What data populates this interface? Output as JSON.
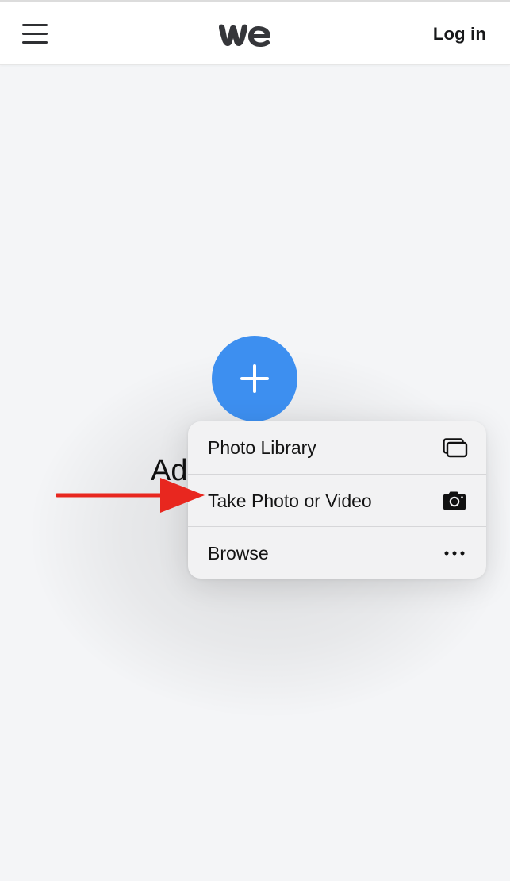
{
  "header": {
    "menu_icon": "hamburger-menu-icon",
    "logo_icon": "wetransfer-we-logo",
    "login_label": "Log in"
  },
  "main": {
    "add_button_icon": "plus-icon",
    "add_button_color": "#3d8ff0",
    "title_visible_text": "Ad"
  },
  "context_menu": {
    "items": [
      {
        "label": "Photo Library",
        "icon": "photo-library-icon"
      },
      {
        "label": "Take Photo or Video",
        "icon": "camera-icon"
      },
      {
        "label": "Browse",
        "icon": "more-horizontal-icon"
      }
    ]
  },
  "annotation": {
    "arrow_color": "#e8271f",
    "arrow_icon": "red-arrow-pointer"
  },
  "colors": {
    "background": "#f4f5f7",
    "header_background": "#ffffff",
    "menu_background": "#f2f2f3",
    "text": "#141414"
  }
}
